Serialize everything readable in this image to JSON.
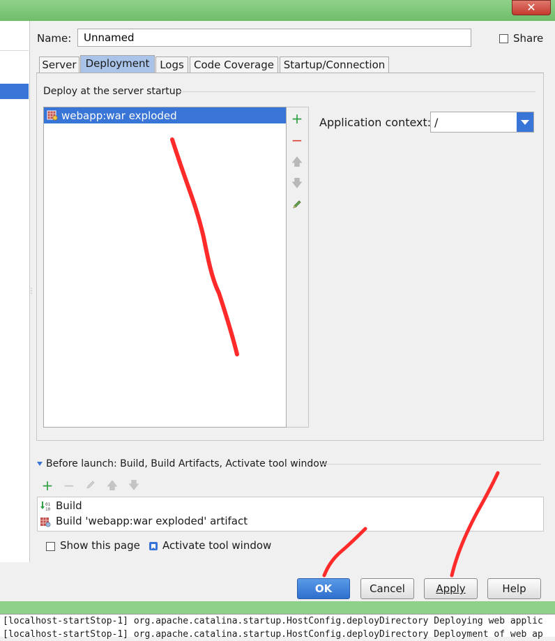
{
  "window": {
    "close_label": "✕"
  },
  "name": {
    "label": "Name:",
    "value": "Unnamed"
  },
  "share": {
    "label": "Share",
    "checked": false
  },
  "tabs": [
    {
      "label": "Server",
      "active": false
    },
    {
      "label": "Deployment",
      "active": true
    },
    {
      "label": "Logs",
      "active": false
    },
    {
      "label": "Code Coverage",
      "active": false
    },
    {
      "label": "Startup/Connection",
      "active": false
    }
  ],
  "deploy": {
    "section_title": "Deploy at the server startup",
    "items": [
      {
        "label": "webapp:war exploded",
        "icon": "artifact-war-icon",
        "selected": true
      }
    ],
    "tools": [
      "add-icon",
      "remove-icon",
      "move-up-icon",
      "move-down-icon",
      "edit-icon"
    ]
  },
  "app_context": {
    "label": "Application context:",
    "value": "/"
  },
  "before_launch": {
    "title": "Before launch: Build, Build Artifacts, Activate tool window",
    "tools": [
      "add-icon",
      "remove-icon",
      "edit-icon",
      "move-up-icon",
      "move-down-icon"
    ],
    "items": [
      {
        "label": "Build",
        "icon": "build-icon"
      },
      {
        "label": "Build 'webapp:war exploded' artifact",
        "icon": "artifact-icon"
      }
    ]
  },
  "options": {
    "show_page": {
      "label": "Show this page",
      "checked": false
    },
    "activate_tool": {
      "label": "Activate tool window",
      "checked": true
    }
  },
  "buttons": {
    "ok": "OK",
    "cancel": "Cancel",
    "apply": "Apply",
    "help": "Help"
  },
  "console": {
    "lines": [
      "[localhost-startStop-1] org.apache.catalina.startup.HostConfig.deployDirectory Deploying web applic",
      "[localhost-startStop-1] org.apache.catalina.startup.HostConfig.deployDirectory Deployment of web ap"
    ]
  },
  "colors": {
    "accent": "#3875d7",
    "annotation": "#ff2a2a",
    "add": "#2ea043",
    "remove": "#d9413a"
  }
}
